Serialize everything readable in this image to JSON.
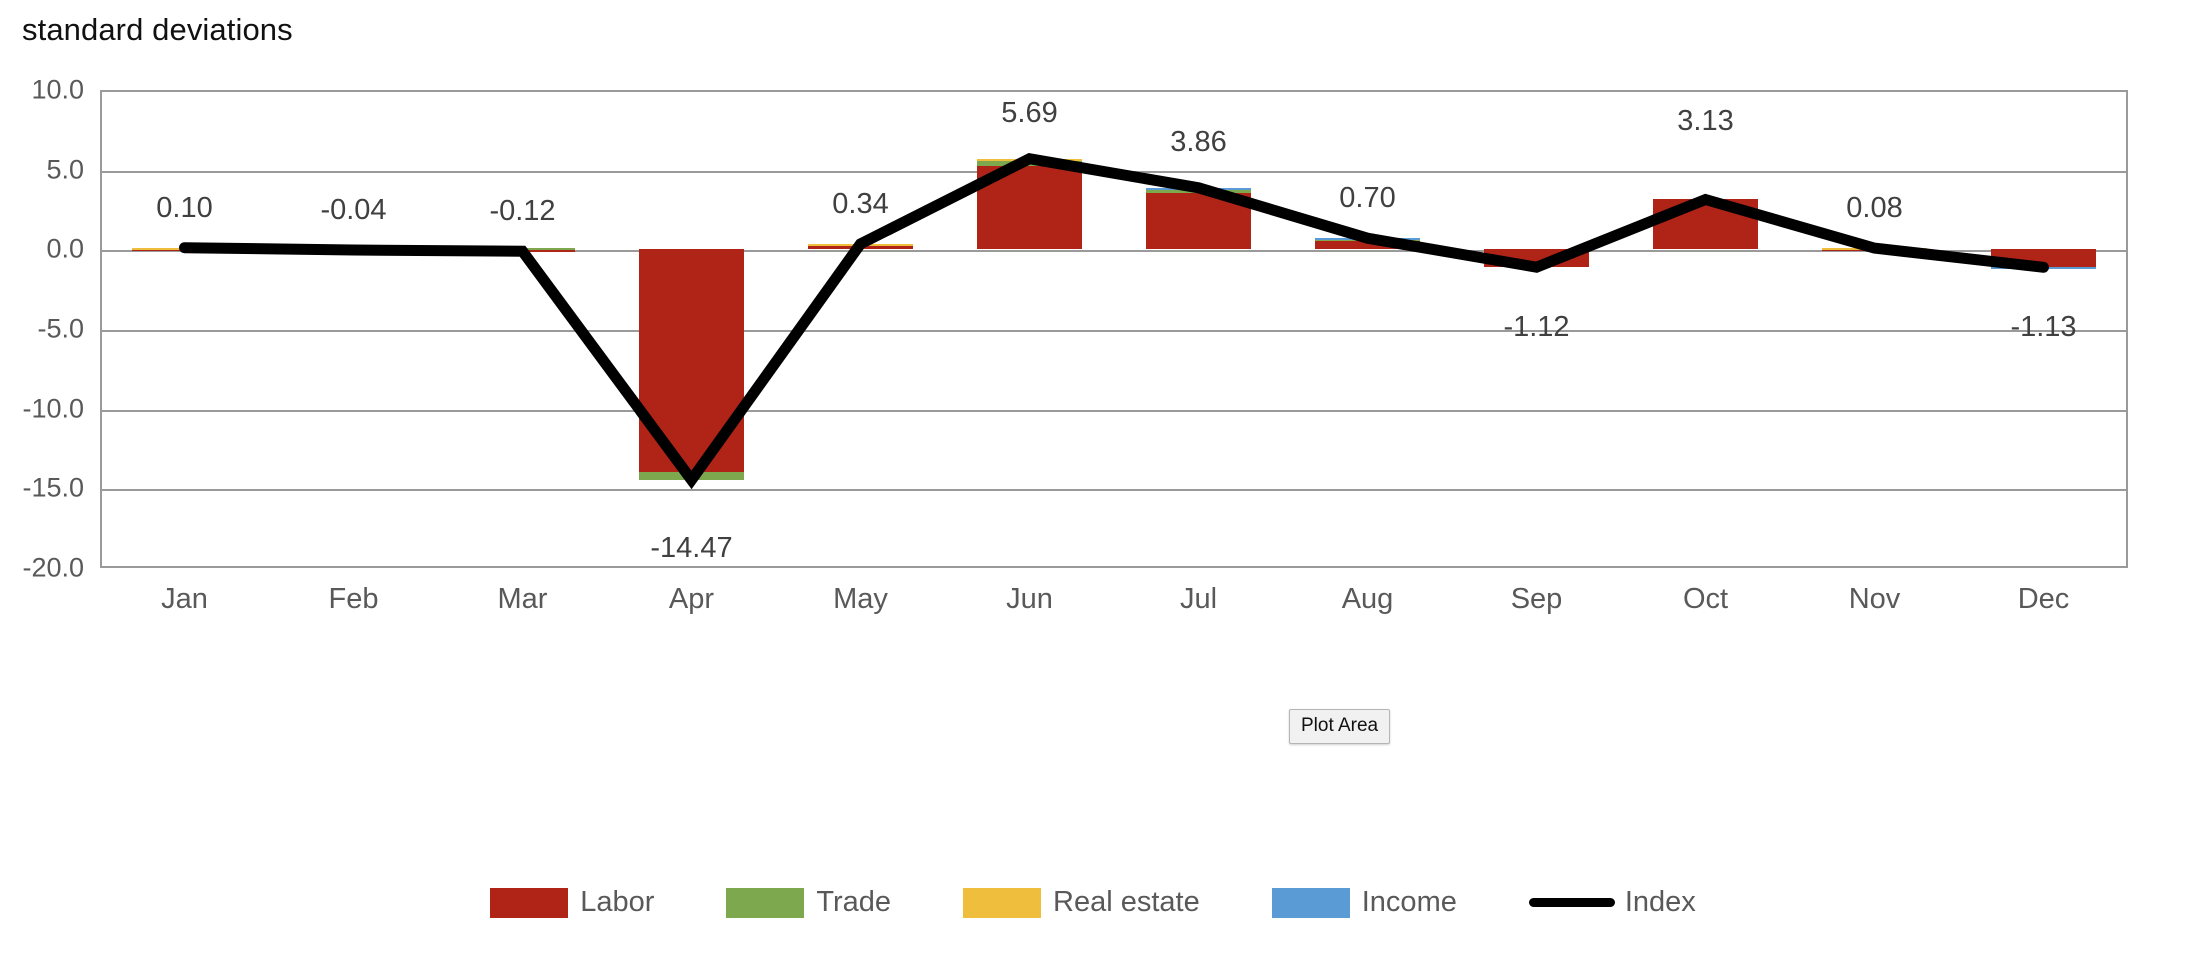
{
  "chart_title": "standard deviations",
  "plot_area_tooltip": "Plot Area",
  "axis": {
    "yticks": [
      "10.0",
      "5.0",
      "0.0",
      "-5.0",
      "-10.0",
      "-15.0",
      "-20.0"
    ],
    "xticks": [
      "Jan",
      "Feb",
      "Mar",
      "Apr",
      "May",
      "Jun",
      "Jul",
      "Aug",
      "Sep",
      "Oct",
      "Nov",
      "Dec"
    ]
  },
  "legend": [
    {
      "label": "Labor",
      "color": "#B02418",
      "type": "bar"
    },
    {
      "label": "Trade",
      "color": "#7DA84D",
      "type": "bar"
    },
    {
      "label": "Real estate",
      "color": "#EFBE3C",
      "type": "bar"
    },
    {
      "label": "Income",
      "color": "#5B9BD5",
      "type": "bar"
    },
    {
      "label": "Index",
      "color": "#000000",
      "type": "line"
    }
  ],
  "chart_data": {
    "type": "bar",
    "title": "standard deviations",
    "xlabel": "",
    "ylabel": "standard deviations",
    "ylim": [
      -20.0,
      10.0
    ],
    "ytick_step": 5.0,
    "grid": true,
    "legend_position": "bottom",
    "stacked": true,
    "categories": [
      "Jan",
      "Feb",
      "Mar",
      "Apr",
      "May",
      "Jun",
      "Jul",
      "Aug",
      "Sep",
      "Oct",
      "Nov",
      "Dec"
    ],
    "series": [
      {
        "name": "Labor",
        "color": "#B02418",
        "values": [
          0.05,
          -0.02,
          -0.18,
          -13.95,
          0.28,
          5.2,
          3.55,
          0.6,
          -1.1,
          3.13,
          0.02,
          -1.1
        ]
      },
      {
        "name": "Trade",
        "color": "#7DA84D",
        "values": [
          0.02,
          -0.01,
          0.06,
          -0.52,
          0.05,
          0.46,
          0.24,
          0.06,
          0.0,
          0.0,
          0.04,
          0.0
        ]
      },
      {
        "name": "Real estate",
        "color": "#EFBE3C",
        "values": [
          0.03,
          -0.01,
          0.0,
          0.0,
          0.01,
          0.03,
          0.04,
          0.03,
          0.0,
          0.0,
          0.02,
          0.0
        ]
      },
      {
        "name": "Income",
        "color": "#5B9BD5",
        "values": [
          0.0,
          0.0,
          0.0,
          0.0,
          0.0,
          0.0,
          0.03,
          0.01,
          0.0,
          0.0,
          0.0,
          -0.03
        ]
      }
    ],
    "line_series": {
      "name": "Index",
      "color": "#000000",
      "values": [
        0.1,
        -0.04,
        -0.12,
        -14.47,
        0.34,
        5.69,
        3.86,
        0.7,
        -1.12,
        3.13,
        0.08,
        -1.13
      ]
    },
    "data_labels": [
      "0.10",
      "-0.04",
      "-0.12",
      "-14.47",
      "0.34",
      "5.69",
      "3.86",
      "0.70",
      "-1.12",
      "3.13",
      "0.08",
      "-1.13"
    ]
  }
}
